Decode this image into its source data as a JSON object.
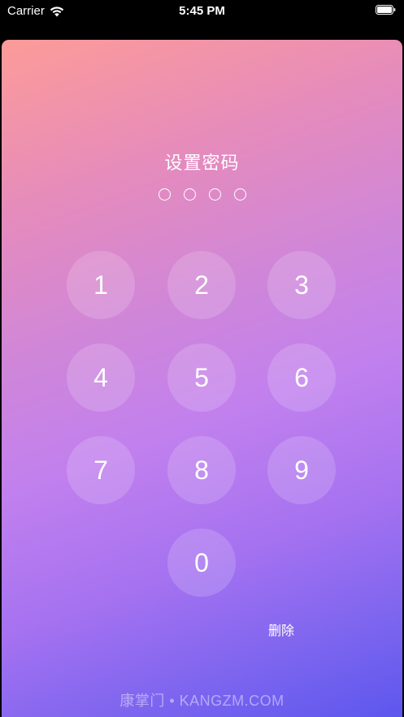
{
  "status_bar": {
    "carrier": "Carrier",
    "time": "5:45 PM",
    "wifi_icon": "wifi-icon",
    "battery_icon": "battery-icon"
  },
  "passcode": {
    "title": "设置密码",
    "dot_count": 4,
    "keys": [
      "1",
      "2",
      "3",
      "4",
      "5",
      "6",
      "7",
      "8",
      "9",
      "0"
    ],
    "delete_label": "删除"
  },
  "watermark": "康掌门 • KANGZM.COM",
  "colors": {
    "gradient_start": "#fd9b98",
    "gradient_mid": "#c180ee",
    "gradient_end": "#5b56ee",
    "key_background": "rgba(255,255,255,0.16)"
  }
}
